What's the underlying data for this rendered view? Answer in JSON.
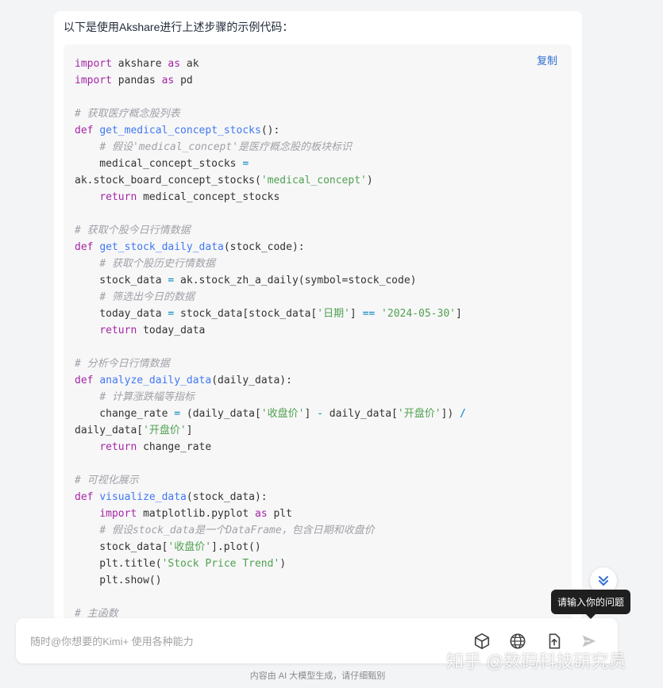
{
  "message": {
    "intro": "以下是使用Akshare进行上述步骤的示例代码：",
    "copy_label": "复制",
    "code_lines": [
      [
        {
          "t": "import",
          "c": "kw"
        },
        {
          "t": " akshare "
        },
        {
          "t": "as",
          "c": "kw"
        },
        {
          "t": " ak"
        }
      ],
      [
        {
          "t": "import",
          "c": "kw"
        },
        {
          "t": " pandas "
        },
        {
          "t": "as",
          "c": "kw"
        },
        {
          "t": " pd"
        }
      ],
      [],
      [
        {
          "t": "# 获取医疗概念股列表",
          "c": "cm"
        }
      ],
      [
        {
          "t": "def",
          "c": "kw"
        },
        {
          "t": " "
        },
        {
          "t": "get_medical_concept_stocks",
          "c": "fn"
        },
        {
          "t": "():"
        }
      ],
      [
        {
          "t": "    "
        },
        {
          "t": "# 假设'medical_concept'是医疗概念股的板块标识",
          "c": "cm"
        }
      ],
      [
        {
          "t": "    medical_concept_stocks "
        },
        {
          "t": "=",
          "c": "op"
        }
      ],
      [
        {
          "t": "ak.stock_board_concept_stocks("
        },
        {
          "t": "'medical_concept'",
          "c": "str"
        },
        {
          "t": ")"
        }
      ],
      [
        {
          "t": "    "
        },
        {
          "t": "return",
          "c": "kw"
        },
        {
          "t": " medical_concept_stocks"
        }
      ],
      [],
      [
        {
          "t": "# 获取个股今日行情数据",
          "c": "cm"
        }
      ],
      [
        {
          "t": "def",
          "c": "kw"
        },
        {
          "t": " "
        },
        {
          "t": "get_stock_daily_data",
          "c": "fn"
        },
        {
          "t": "(stock_code):"
        }
      ],
      [
        {
          "t": "    "
        },
        {
          "t": "# 获取个股历史行情数据",
          "c": "cm"
        }
      ],
      [
        {
          "t": "    stock_data "
        },
        {
          "t": "=",
          "c": "op"
        },
        {
          "t": " ak.stock_zh_a_daily(symbol=stock_code)"
        }
      ],
      [
        {
          "t": "    "
        },
        {
          "t": "# 筛选出今日的数据",
          "c": "cm"
        }
      ],
      [
        {
          "t": "    today_data "
        },
        {
          "t": "=",
          "c": "op"
        },
        {
          "t": " stock_data[stock_data["
        },
        {
          "t": "'日期'",
          "c": "str"
        },
        {
          "t": "] "
        },
        {
          "t": "==",
          "c": "op"
        },
        {
          "t": " "
        },
        {
          "t": "'2024-05-30'",
          "c": "str"
        },
        {
          "t": "]"
        }
      ],
      [
        {
          "t": "    "
        },
        {
          "t": "return",
          "c": "kw"
        },
        {
          "t": " today_data"
        }
      ],
      [],
      [
        {
          "t": "# 分析今日行情数据",
          "c": "cm"
        }
      ],
      [
        {
          "t": "def",
          "c": "kw"
        },
        {
          "t": " "
        },
        {
          "t": "analyze_daily_data",
          "c": "fn"
        },
        {
          "t": "(daily_data):"
        }
      ],
      [
        {
          "t": "    "
        },
        {
          "t": "# 计算涨跌幅等指标",
          "c": "cm"
        }
      ],
      [
        {
          "t": "    change_rate "
        },
        {
          "t": "=",
          "c": "op"
        },
        {
          "t": " (daily_data["
        },
        {
          "t": "'收盘价'",
          "c": "str"
        },
        {
          "t": "] "
        },
        {
          "t": "-",
          "c": "op"
        },
        {
          "t": " daily_data["
        },
        {
          "t": "'开盘价'",
          "c": "str"
        },
        {
          "t": "]) "
        },
        {
          "t": "/",
          "c": "op"
        }
      ],
      [
        {
          "t": "daily_data["
        },
        {
          "t": "'开盘价'",
          "c": "str"
        },
        {
          "t": "]"
        }
      ],
      [
        {
          "t": "    "
        },
        {
          "t": "return",
          "c": "kw"
        },
        {
          "t": " change_rate"
        }
      ],
      [],
      [
        {
          "t": "# 可视化展示",
          "c": "cm"
        }
      ],
      [
        {
          "t": "def",
          "c": "kw"
        },
        {
          "t": " "
        },
        {
          "t": "visualize_data",
          "c": "fn"
        },
        {
          "t": "(stock_data):"
        }
      ],
      [
        {
          "t": "    "
        },
        {
          "t": "import",
          "c": "kw"
        },
        {
          "t": " matplotlib.pyplot "
        },
        {
          "t": "as",
          "c": "kw"
        },
        {
          "t": " plt"
        }
      ],
      [
        {
          "t": "    "
        },
        {
          "t": "# 假设stock_data是一个DataFrame，包含日期和收盘价",
          "c": "cm"
        }
      ],
      [
        {
          "t": "    stock_data["
        },
        {
          "t": "'收盘价'",
          "c": "str"
        },
        {
          "t": "].plot()"
        }
      ],
      [
        {
          "t": "    plt.title("
        },
        {
          "t": "'Stock Price Trend'",
          "c": "str"
        },
        {
          "t": ")"
        }
      ],
      [
        {
          "t": "    plt.show()"
        }
      ],
      [],
      [
        {
          "t": "# 主函数",
          "c": "cm"
        }
      ]
    ]
  },
  "input": {
    "placeholder": "随时@你想要的Kimi+ 使用各种能力"
  },
  "toolbar": {
    "icons": [
      "cube-icon",
      "globe-icon",
      "upload-file-icon",
      "send-icon"
    ]
  },
  "tooltip": {
    "text": "请输入你的问题"
  },
  "footer": {
    "note": "内容由 AI 大模型生成，请仔细甄别"
  },
  "watermark": {
    "text": "知乎 @数码科技研究员"
  },
  "colors": {
    "keyword": "#a626a4",
    "function": "#4078f2",
    "string": "#50a14f",
    "comment": "#a0a1a7",
    "link": "#2f6fd0"
  }
}
